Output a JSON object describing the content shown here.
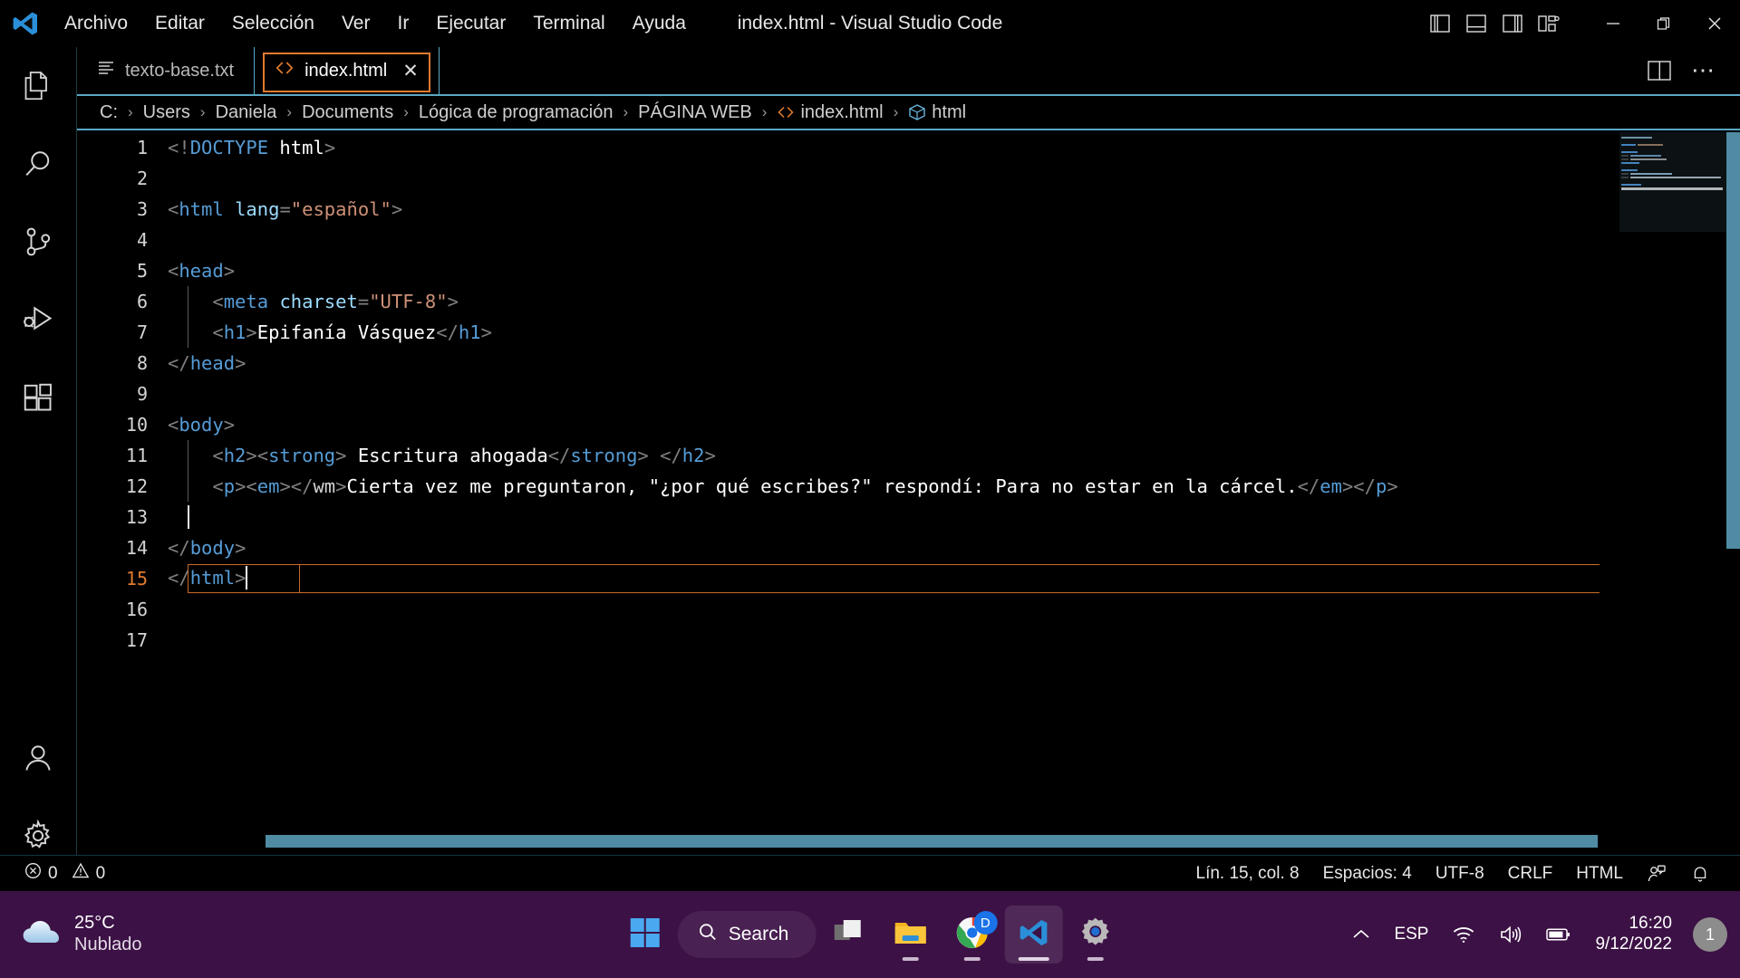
{
  "window": {
    "title": "index.html - Visual Studio Code",
    "app_icon": "vscode-logo-icon",
    "minimize_label": "─",
    "maximize_label": "❐",
    "close_label": "✕"
  },
  "menubar": {
    "items": [
      {
        "label": "Archivo",
        "name": "menu-archivo"
      },
      {
        "label": "Editar",
        "name": "menu-editar"
      },
      {
        "label": "Selección",
        "name": "menu-seleccion"
      },
      {
        "label": "Ver",
        "name": "menu-ver"
      },
      {
        "label": "Ir",
        "name": "menu-ir"
      },
      {
        "label": "Ejecutar",
        "name": "menu-ejecutar"
      },
      {
        "label": "Terminal",
        "name": "menu-terminal"
      },
      {
        "label": "Ayuda",
        "name": "menu-ayuda"
      }
    ]
  },
  "layout_buttons": [
    {
      "name": "toggle-primary-sidebar-icon",
      "title": "Alternar barra lateral primaria"
    },
    {
      "name": "toggle-panel-icon",
      "title": "Alternar panel"
    },
    {
      "name": "toggle-secondary-sidebar-icon",
      "title": "Alternar barra lateral secundaria"
    },
    {
      "name": "customize-layout-icon",
      "title": "Personalizar diseño"
    }
  ],
  "activitybar": {
    "items": [
      {
        "name": "sidebar-item-explorer",
        "icon": "files-icon",
        "label": "Explorador"
      },
      {
        "name": "sidebar-item-search",
        "icon": "search-icon",
        "label": "Buscar"
      },
      {
        "name": "sidebar-item-source-control",
        "icon": "source-control-icon",
        "label": "Control de código fuente"
      },
      {
        "name": "sidebar-item-run-debug",
        "icon": "run-and-debug-icon",
        "label": "Ejecutar y depurar"
      },
      {
        "name": "sidebar-item-extensions",
        "icon": "extensions-icon",
        "label": "Extensiones"
      }
    ],
    "bottom": [
      {
        "name": "sidebar-item-accounts",
        "icon": "account-icon",
        "label": "Cuentas"
      },
      {
        "name": "sidebar-item-settings",
        "icon": "gear-icon",
        "label": "Administrar"
      }
    ]
  },
  "tabs": [
    {
      "label": "texto-base.txt",
      "icon": "text-file-icon",
      "active": false,
      "closeable": false
    },
    {
      "label": "index.html",
      "icon": "html-file-icon",
      "active": true,
      "closeable": true,
      "close_label": "✕"
    }
  ],
  "tabbar_actions": [
    {
      "name": "split-editor-icon",
      "label": "Dividir editor"
    },
    {
      "name": "more-actions-icon",
      "label": "⋯"
    }
  ],
  "breadcrumb": {
    "separator": "›",
    "items": [
      {
        "label": "C:",
        "icon": null
      },
      {
        "label": "Users",
        "icon": null
      },
      {
        "label": "Daniela",
        "icon": null
      },
      {
        "label": "Documents",
        "icon": null
      },
      {
        "label": "Lógica de programación",
        "icon": null
      },
      {
        "label": "PÁGINA WEB",
        "icon": null
      },
      {
        "label": "index.html",
        "icon": "html-file-icon"
      },
      {
        "label": "html",
        "icon": "symbol-tag-icon"
      }
    ]
  },
  "editor": {
    "language": "HTML",
    "cursor_line": 15,
    "cursor_column": 8,
    "lines": [
      {
        "n": 1,
        "text": "<!DOCTYPE html>",
        "indent": 0
      },
      {
        "n": 2,
        "text": "",
        "indent": 0
      },
      {
        "n": 3,
        "text": "<html lang=\"español\">",
        "indent": 0
      },
      {
        "n": 4,
        "text": "",
        "indent": 0
      },
      {
        "n": 5,
        "text": "<head>",
        "indent": 0
      },
      {
        "n": 6,
        "text": "    <meta charset=\"UTF-8\">",
        "indent": 1
      },
      {
        "n": 7,
        "text": "    <h1>Epifanía Vásquez</h1>",
        "indent": 1
      },
      {
        "n": 8,
        "text": "</head>",
        "indent": 0
      },
      {
        "n": 9,
        "text": "",
        "indent": 0
      },
      {
        "n": 10,
        "text": "<body>",
        "indent": 0
      },
      {
        "n": 11,
        "text": "    <h2><strong> Escritura ahogada</strong> </h2>",
        "indent": 1
      },
      {
        "n": 12,
        "text": "    <p><em></wm>Cierta vez me preguntaron, \"¿por qué escribes?\" respondí: Para no estar en la cárcel.</em></p>",
        "indent": 1
      },
      {
        "n": 13,
        "text": "",
        "indent": 1
      },
      {
        "n": 14,
        "text": "</body>",
        "indent": 0
      },
      {
        "n": 15,
        "text": "</html>",
        "indent": 0
      },
      {
        "n": 16,
        "text": "",
        "indent": 0
      },
      {
        "n": 17,
        "text": "",
        "indent": 0
      }
    ]
  },
  "statusbar": {
    "errors": "0",
    "warnings": "0",
    "position": "Lín. 15, col. 8",
    "indentation": "Espacios: 4",
    "encoding": "UTF-8",
    "eol": "CRLF",
    "language": "HTML",
    "feedback_icon": "feedback-smiley-icon",
    "notifications_icon": "bell-icon"
  },
  "taskbar": {
    "weather": {
      "temperature": "25°C",
      "condition": "Nublado",
      "icon": "cloud-icon"
    },
    "search_placeholder": "Search",
    "items": [
      {
        "name": "taskbar-start-button",
        "icon": "windows-start-icon",
        "running": false,
        "active": false
      },
      {
        "name": "taskbar-search-button",
        "icon": "search-icon",
        "running": false,
        "active": false
      },
      {
        "name": "taskbar-task-view-button",
        "icon": "task-view-icon",
        "running": false,
        "active": false
      },
      {
        "name": "taskbar-file-explorer-button",
        "icon": "folder-icon",
        "running": true,
        "active": false
      },
      {
        "name": "taskbar-chrome-button",
        "icon": "chrome-icon",
        "running": true,
        "active": false,
        "badge": "D"
      },
      {
        "name": "taskbar-vscode-button",
        "icon": "vscode-icon",
        "running": true,
        "active": true
      },
      {
        "name": "taskbar-settings-button",
        "icon": "gear-icon",
        "running": true,
        "active": false
      }
    ],
    "tray": {
      "overflow_icon": "chevron-up-icon",
      "language": "ESP",
      "wifi_icon": "wifi-icon",
      "volume_icon": "speaker-icon",
      "battery_icon": "battery-icon",
      "time": "16:20",
      "date": "9/12/2022",
      "notification_count": "1"
    }
  },
  "colors": {
    "accent_orange": "#e07a2f",
    "accent_blue": "#5aa8c4",
    "tag_blue": "#569cd6",
    "attr_blue": "#9cdcfe",
    "string_orange": "#ce9178",
    "taskbar_purple": "#3c1145",
    "editor_bg": "#000000"
  }
}
